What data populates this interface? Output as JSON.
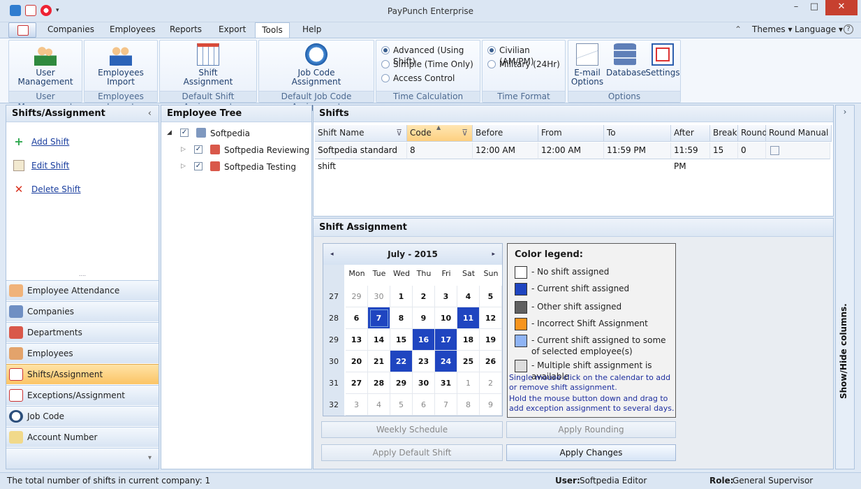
{
  "window": {
    "title": "PayPunch Enterprise"
  },
  "menu_tabs": [
    "Companies",
    "Employees",
    "Reports",
    "Export",
    "Tools",
    "Help"
  ],
  "menu_active": "Tools",
  "menu_right": {
    "themes": "Themes",
    "language": "Language"
  },
  "ribbon": {
    "user_management": {
      "label1": "User",
      "label2": "Management",
      "group": "User Management"
    },
    "employees_import": {
      "label1": "Employees",
      "label2": "Import",
      "group": "Employees Import"
    },
    "shift_assignment": {
      "label1": "Shift",
      "label2": "Assignment",
      "group": "Default Shift Assignment"
    },
    "job_code": {
      "label1": "Job Code",
      "label2": "Assignment",
      "group": "Default Job Code Assignment"
    },
    "time_calculation": {
      "group": "Time Calculation",
      "options": [
        "Advanced (Using Shift)",
        "Simple (Time Only)",
        "Access Control"
      ],
      "selected": 0
    },
    "time_format": {
      "group": "Time Format",
      "options": [
        "Civilian (AM/PM)",
        "Military (24Hr)"
      ],
      "selected": 0
    },
    "options": {
      "group": "Options",
      "email1": "E-mail",
      "email2": "Options",
      "database": "Database",
      "settings": "Settings"
    }
  },
  "left_panel": {
    "title": "Shifts/Assignment",
    "actions": [
      "Add Shift",
      "Edit Shift",
      "Delete Shift"
    ],
    "nav": [
      "Employee Attendance",
      "Companies",
      "Departments",
      "Employees",
      "Shifts/Assignment",
      "Exceptions/Assignment",
      "Job Code",
      "Account Number"
    ],
    "nav_active": "Shifts/Assignment"
  },
  "employee_tree": {
    "title": "Employee Tree",
    "root": "Softpedia",
    "children": [
      "Softpedia Reviewing",
      "Softpedia Testing"
    ]
  },
  "shifts": {
    "title": "Shifts",
    "columns": [
      "Shift Name",
      "Code",
      "Before",
      "From",
      "To",
      "After",
      "Break",
      "Round",
      "Round Manual"
    ],
    "rows": [
      [
        "Softpedia standard shift",
        "8",
        "12:00 AM",
        "12:00 AM",
        "11:59 PM",
        "11:59 PM",
        "15",
        "0",
        ""
      ]
    ]
  },
  "shift_assignment": {
    "title": "Shift Assignment",
    "calendar": {
      "month": "July - 2015",
      "weekdays": [
        "Mon",
        "Tue",
        "Wed",
        "Thu",
        "Fri",
        "Sat",
        "Sun"
      ],
      "weeks": [
        "27",
        "28",
        "29",
        "30",
        "31",
        "32"
      ],
      "days": [
        [
          "29",
          "30",
          "1",
          "2",
          "3",
          "4",
          "5"
        ],
        [
          "6",
          "7",
          "8",
          "9",
          "10",
          "11",
          "12"
        ],
        [
          "13",
          "14",
          "15",
          "16",
          "17",
          "18",
          "19"
        ],
        [
          "20",
          "21",
          "22",
          "23",
          "24",
          "25",
          "26"
        ],
        [
          "27",
          "28",
          "29",
          "30",
          "31",
          "1",
          "2"
        ],
        [
          "3",
          "4",
          "5",
          "6",
          "7",
          "8",
          "9"
        ]
      ]
    },
    "legend": {
      "title": "Color legend:",
      "items": [
        {
          "color": "#ffffff",
          "label": "- No shift assigned"
        },
        {
          "color": "#1f45c0",
          "label": "- Current shift assigned"
        },
        {
          "color": "#606060",
          "label": "- Other shift assigned"
        },
        {
          "color": "#f7941d",
          "label": "- Incorrect Shift Assignment"
        },
        {
          "color": "#8fb4f5",
          "label": "- Current shift assigned to some of selected employee(s)"
        },
        {
          "color": "#dddddd",
          "label": "- Multiple shift assignment is available"
        }
      ]
    },
    "hint1": "Single mouse click on the calendar to add or remove shift assignment.",
    "hint2": "Hold the mouse button down and drag to add exception assignment to several days.",
    "buttons": {
      "weekly": "Weekly Schedule",
      "rounding": "Apply Rounding",
      "default_shift": "Apply Default Shift",
      "apply_changes": "Apply Changes"
    }
  },
  "right_strip": {
    "label": "Show/Hide columns."
  },
  "status": {
    "message": "The total number of shifts in current company: 1",
    "user_label": "User:",
    "user_value": "Softpedia Editor",
    "role_label": "Role:",
    "role_value": "General Supervisor"
  }
}
